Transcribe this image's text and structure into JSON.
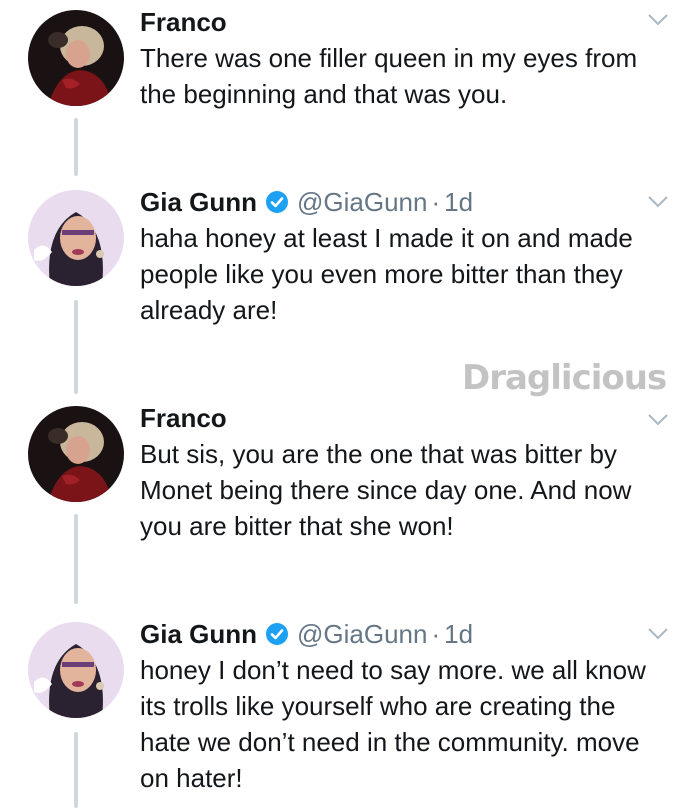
{
  "tweets": [
    {
      "name": "Franco",
      "handle": "",
      "dot": "",
      "time": "",
      "verified": false,
      "text": "There was one filler queen in my eyes from the beginning and that was you."
    },
    {
      "name": "Gia Gunn",
      "handle": "@GiaGunn",
      "dot": "·",
      "time": "1d",
      "verified": true,
      "text": "haha honey at least I made it on and made people like you even more bitter than they already are!"
    },
    {
      "name": "Franco",
      "handle": "",
      "dot": "",
      "time": "",
      "verified": false,
      "text": "But sis, you are the one that was bitter by Monet being there since day one. And now you are bitter that she won!"
    },
    {
      "name": "Gia Gunn",
      "handle": "@GiaGunn",
      "dot": "·",
      "time": "1d",
      "verified": true,
      "text": "honey I don’t need to say more. we all know its trolls like yourself who are creating the hate we don’t need in the community. move on hater!"
    }
  ],
  "watermark": "Draglicious",
  "icons": {
    "verified": "verified-badge-icon",
    "caret": "chevron-down-icon"
  },
  "colors": {
    "verified": "#1da1f2",
    "muted": "#657786",
    "thread_line": "#cfd8de",
    "text": "#14171a"
  }
}
